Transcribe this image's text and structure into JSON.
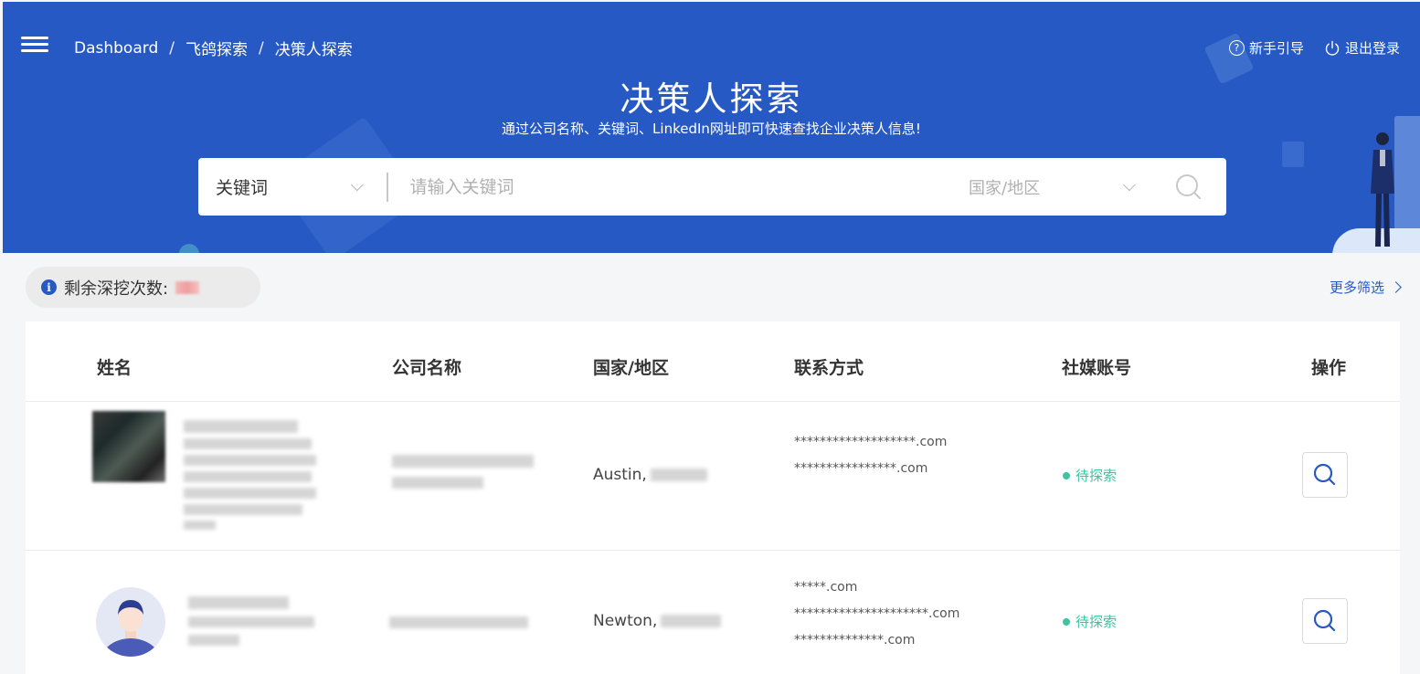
{
  "breadcrumb": [
    "Dashboard",
    "飞鸽探索",
    "决策人探索"
  ],
  "top_actions": {
    "guide": "新手引导",
    "logout": "退出登录"
  },
  "hero": {
    "title": "决策人探索",
    "subtitle": "通过公司名称、关键词、LinkedIn网址即可快速查找企业决策人信息!"
  },
  "search": {
    "type_selected": "关键词",
    "placeholder": "请输入关键词",
    "country_placeholder": "国家/地区"
  },
  "quota": {
    "label": "剩余深挖次数:"
  },
  "more_filter": "更多筛选",
  "table": {
    "headers": [
      "姓名",
      "公司名称",
      "国家/地区",
      "联系方式",
      "社媒账号",
      "操作"
    ],
    "rows": [
      {
        "city": "Austin,",
        "emails": [
          "*******************.com",
          "****************.com"
        ],
        "status": "待探索"
      },
      {
        "city": "Newton,",
        "emails": [
          "*****.com",
          "*********************.com",
          "**************.com"
        ],
        "status": "待探索"
      }
    ]
  },
  "colors": {
    "primary": "#2659c4",
    "status_green": "#3cc3a0"
  }
}
